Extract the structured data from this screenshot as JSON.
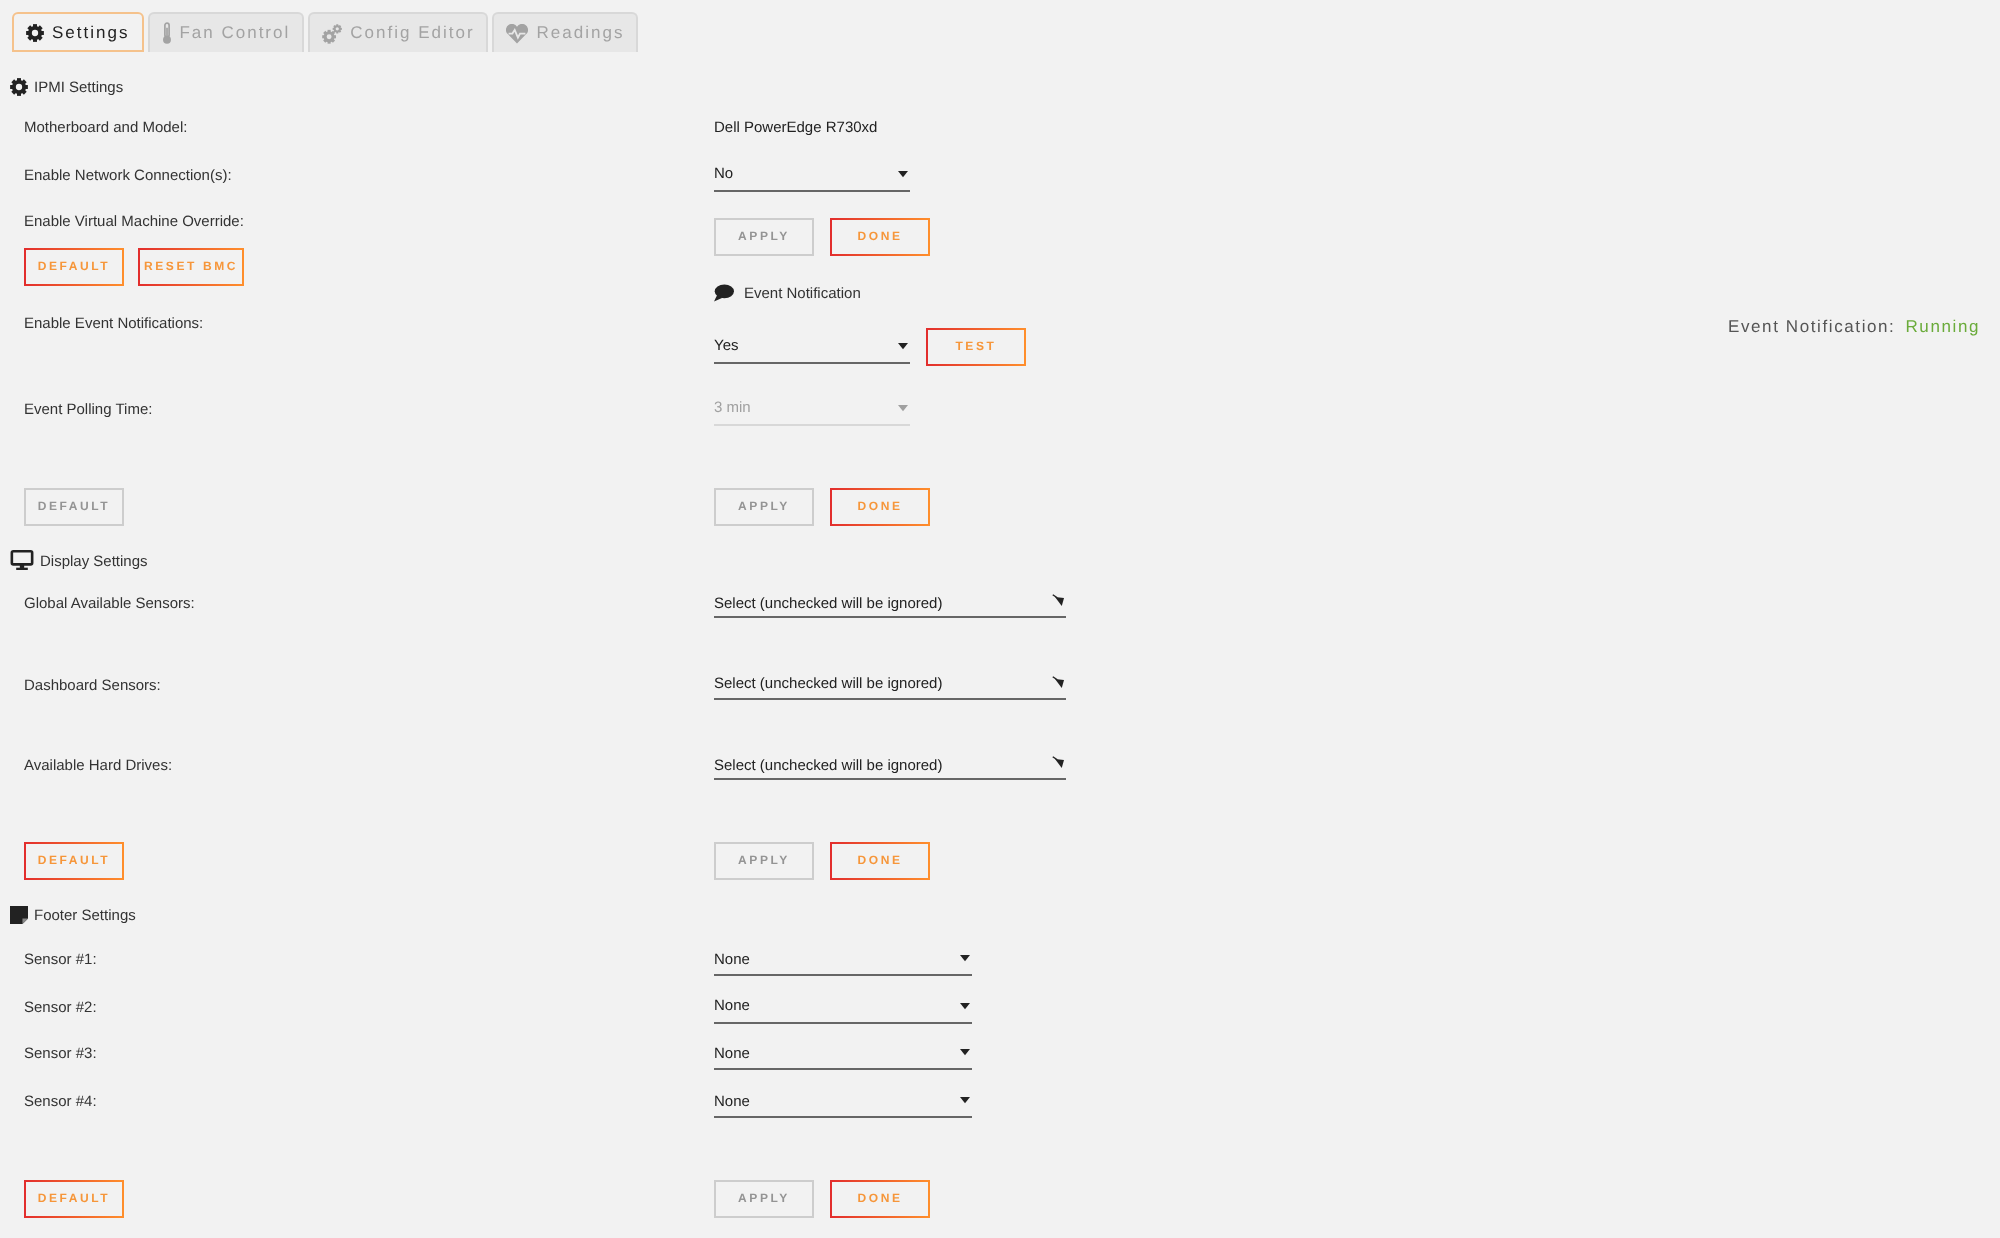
{
  "tabs": [
    {
      "label": "Settings",
      "selected": true
    },
    {
      "label": "Fan Control",
      "selected": false
    },
    {
      "label": "Config Editor",
      "selected": false
    },
    {
      "label": "Readings",
      "selected": false
    }
  ],
  "ipmi_settings": {
    "title": "IPMI Settings",
    "fields": [
      {
        "kind": "text",
        "label": "Motherboard and Model:",
        "value": "Dell PowerEdge R730xd",
        "disabled": false
      },
      {
        "kind": "select",
        "label": "Enable Network Connection(s):",
        "value": "No",
        "disabled": false
      }
    ],
    "override_label": "Enable Virtual Machine Override:",
    "buttons": {
      "left": [
        {
          "label": "DEFAULT",
          "disabled": false
        },
        {
          "label": "RESET BMC",
          "disabled": false
        }
      ],
      "right": [
        {
          "label": "APPLY",
          "disabled": true
        },
        {
          "label": "DONE",
          "disabled": false
        }
      ]
    }
  },
  "event_notification": {
    "title": "Event Notification",
    "status_label": "Event Notification:",
    "status": "Running",
    "fields": [
      {
        "kind": "select",
        "label": "Enable Event Notifications:",
        "value": "Yes",
        "disabled": false,
        "button": {
          "label": "TEST",
          "disabled": false
        }
      },
      {
        "kind": "select",
        "label": "Event Polling Time:",
        "value": "3 min",
        "disabled": true
      }
    ],
    "buttons": {
      "left": [
        {
          "label": "DEFAULT",
          "disabled": true
        }
      ],
      "right": [
        {
          "label": "APPLY",
          "disabled": true
        },
        {
          "label": "DONE",
          "disabled": false
        }
      ]
    }
  },
  "display_settings": {
    "title": "Display Settings",
    "fields": [
      {
        "kind": "multiselect",
        "label": "Global Available Sensors:",
        "value": "Select (unchecked will be ignored)",
        "disabled": false
      },
      {
        "kind": "multiselect",
        "label": "Dashboard Sensors:",
        "value": "Select (unchecked will be ignored)",
        "disabled": false
      },
      {
        "kind": "multiselect",
        "label": "Available Hard Drives:",
        "value": "Select (unchecked will be ignored)",
        "disabled": false
      }
    ],
    "buttons": {
      "left": [
        {
          "label": "DEFAULT",
          "disabled": false
        }
      ],
      "right": [
        {
          "label": "APPLY",
          "disabled": true
        },
        {
          "label": "DONE",
          "disabled": false
        }
      ]
    }
  },
  "footer_settings": {
    "title": "Footer Settings",
    "fields": [
      {
        "kind": "select",
        "label": "Sensor #1:",
        "value": "None",
        "disabled": false
      },
      {
        "kind": "select",
        "label": "Sensor #2:",
        "value": "None",
        "disabled": false
      },
      {
        "kind": "select",
        "label": "Sensor #3:",
        "value": "None",
        "disabled": false
      },
      {
        "kind": "select",
        "label": "Sensor #4:",
        "value": "None",
        "disabled": false
      }
    ],
    "buttons": {
      "left": [
        {
          "label": "DEFAULT",
          "disabled": false
        }
      ],
      "right": [
        {
          "label": "APPLY",
          "disabled": true
        },
        {
          "label": "DONE",
          "disabled": false
        }
      ]
    }
  }
}
